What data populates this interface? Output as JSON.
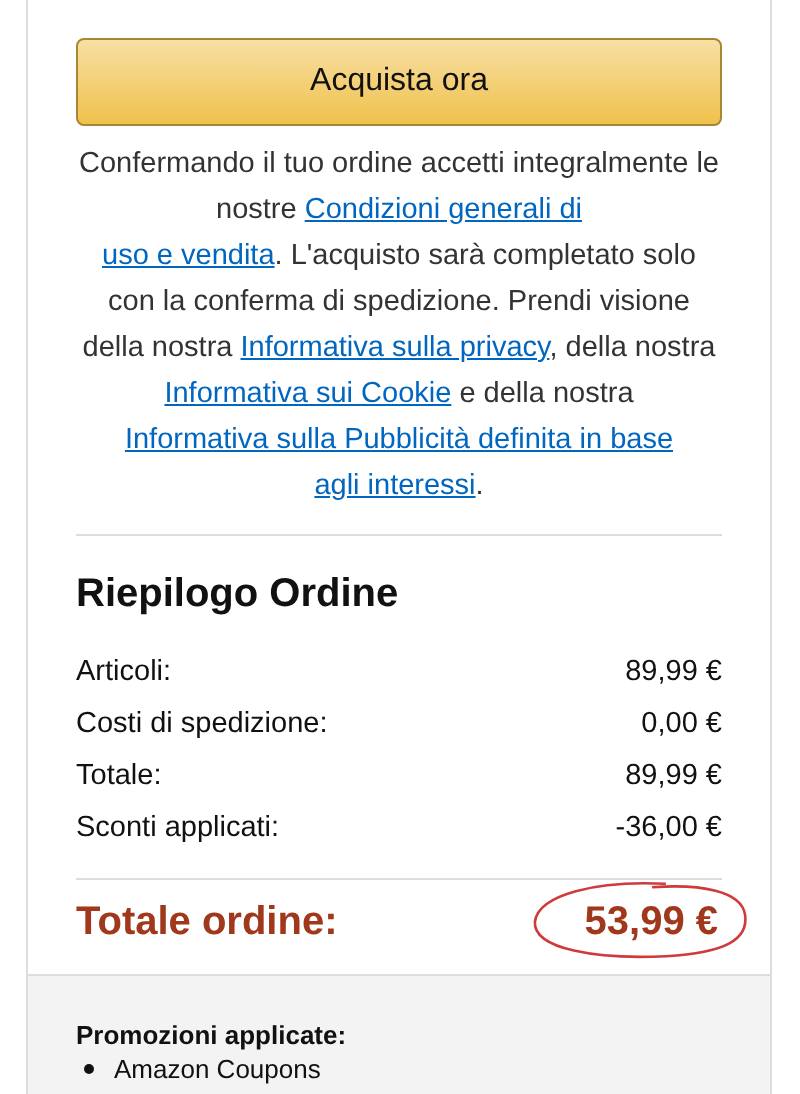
{
  "buy_button": {
    "label": "Acquista ora"
  },
  "terms": [
    {
      "kind": "text",
      "text": "Confermando il tuo ordine accetti integralmente le nostre "
    },
    {
      "kind": "link",
      "text": "Condizioni generali di"
    },
    {
      "kind": "break"
    },
    {
      "kind": "link",
      "text": "uso e vendita"
    },
    {
      "kind": "text",
      "text": ". L'acquisto sarà completato solo con la conferma di spedizione. Prendi visione della nostra "
    },
    {
      "kind": "link",
      "text": "Informativa sulla privacy"
    },
    {
      "kind": "text",
      "text": ", della nostra "
    },
    {
      "kind": "link",
      "text": "Informativa sui Cookie"
    },
    {
      "kind": "text",
      "text": " e della nostra "
    },
    {
      "kind": "link",
      "text": "Informativa sulla Pubblicità definita in base"
    },
    {
      "kind": "break"
    },
    {
      "kind": "link",
      "text": "agli interessi"
    },
    {
      "kind": "text",
      "text": "."
    }
  ],
  "summary": {
    "title": "Riepilogo Ordine",
    "rows": [
      {
        "label": "Articoli:",
        "value": "89,99 €"
      },
      {
        "label": "Costi di spedizione:",
        "value": "0,00 €"
      },
      {
        "label": "Totale:",
        "value": "89,99 €"
      },
      {
        "label": "Sconti applicati:",
        "value": "-36,00 €"
      }
    ],
    "total": {
      "label": "Totale ordine:",
      "value": "53,99 €"
    }
  },
  "promotions": {
    "title": "Promozioni applicate:",
    "items": [
      "Amazon Coupons"
    ]
  }
}
